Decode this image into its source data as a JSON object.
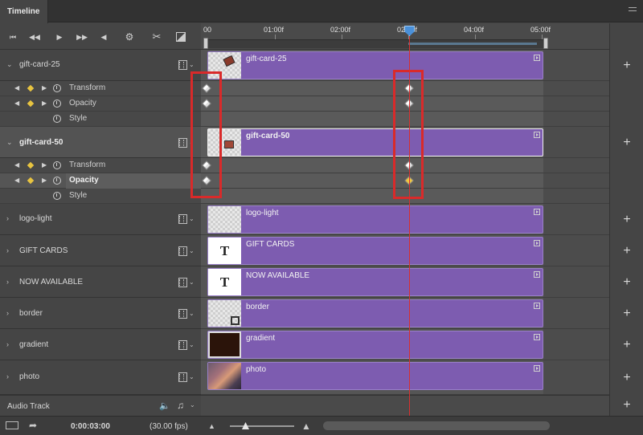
{
  "panel": {
    "tab": "Timeline"
  },
  "ruler": {
    "labels": [
      "00",
      "01:00f",
      "02:00f",
      "02:00f",
      "04:00f",
      "05:00f"
    ]
  },
  "layers": [
    {
      "name": "gift-card-25",
      "expanded": true,
      "selected": false,
      "properties": [
        {
          "label": "Transform"
        },
        {
          "label": "Opacity"
        },
        {
          "label": "Style"
        }
      ]
    },
    {
      "name": "gift-card-50",
      "expanded": true,
      "selected": true,
      "properties": [
        {
          "label": "Transform"
        },
        {
          "label": "Opacity"
        },
        {
          "label": "Style"
        }
      ]
    },
    {
      "name": "logo-light",
      "expanded": false
    },
    {
      "name": "GIFT CARDS",
      "expanded": false
    },
    {
      "name": "NOW AVAILABLE",
      "expanded": false
    },
    {
      "name": "border",
      "expanded": false
    },
    {
      "name": "gradient",
      "expanded": false
    },
    {
      "name": "photo",
      "expanded": false
    }
  ],
  "audio": {
    "label": "Audio Track"
  },
  "thumbs": {
    "text_glyph": "T"
  },
  "footer": {
    "timecode": "0:00:03:00",
    "fps": "(30.00 fps)"
  },
  "colors": {
    "clip": "#7d5cb0",
    "playhead": "#d83030",
    "highlight_box": "#d92a2a",
    "keyframe_selected": "#f0c840"
  },
  "icons": [
    "go-to-first-frame-icon",
    "previous-frame-icon",
    "play-icon",
    "next-frame-icon",
    "audio-mute-icon",
    "settings-gear-icon",
    "split-scissors-icon",
    "transition-icon",
    "film-strip-icon",
    "stopwatch-icon",
    "keyframe-icon",
    "plus-icon",
    "render-icon",
    "convert-icon"
  ]
}
